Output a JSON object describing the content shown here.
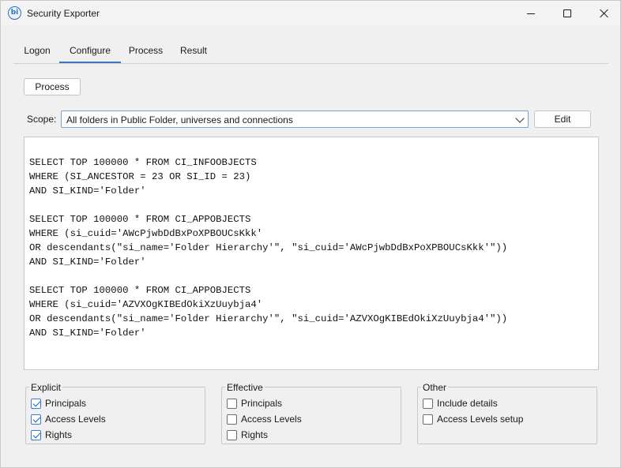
{
  "window": {
    "title": "Security Exporter",
    "app_icon_text": "bi"
  },
  "tabs": [
    {
      "label": "Logon",
      "active": false
    },
    {
      "label": "Configure",
      "active": true
    },
    {
      "label": "Process",
      "active": false
    },
    {
      "label": "Result",
      "active": false
    }
  ],
  "toolbar": {
    "process_label": "Process"
  },
  "scope": {
    "label": "Scope:",
    "selected": "All folders in Public Folder, universes and connections",
    "edit_label": "Edit"
  },
  "query": {
    "lines": [
      "SELECT TOP 100000 * FROM CI_INFOOBJECTS",
      "WHERE (SI_ANCESTOR = 23 OR SI_ID = 23)",
      "AND SI_KIND='Folder'",
      "",
      "SELECT TOP 100000 * FROM CI_APPOBJECTS",
      "WHERE (si_cuid='AWcPjwbDdBxPoXPBOUCsKkk'",
      "OR descendants(\"si_name='Folder Hierarchy'\", \"si_cuid='AWcPjwbDdBxPoXPBOUCsKkk'\"))",
      "AND SI_KIND='Folder'",
      "",
      "SELECT TOP 100000 * FROM CI_APPOBJECTS",
      "WHERE (si_cuid='AZVXOgKIBEdOkiXzUuybja4'",
      "OR descendants(\"si_name='Folder Hierarchy'\", \"si_cuid='AZVXOgKIBEdOkiXzUuybja4'\"))",
      "AND SI_KIND='Folder'"
    ]
  },
  "groups": {
    "explicit": {
      "title": "Explicit",
      "items": [
        {
          "label": "Principals",
          "checked": true
        },
        {
          "label": "Access Levels",
          "checked": true
        },
        {
          "label": "Rights",
          "checked": true
        }
      ]
    },
    "effective": {
      "title": "Effective",
      "items": [
        {
          "label": "Principals",
          "checked": false
        },
        {
          "label": "Access Levels",
          "checked": false
        },
        {
          "label": "Rights",
          "checked": false
        }
      ]
    },
    "other": {
      "title": "Other",
      "items": [
        {
          "label": "Include details",
          "checked": false
        },
        {
          "label": "Access Levels setup",
          "checked": false
        }
      ]
    }
  },
  "colors": {
    "accent": "#3a77c9",
    "check": "#1f5fb8"
  }
}
